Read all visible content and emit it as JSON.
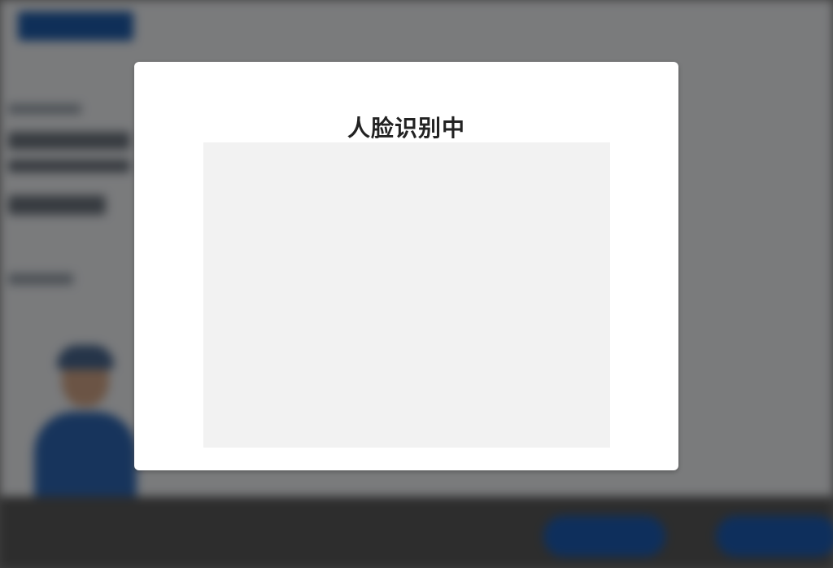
{
  "face_recognition_modal": {
    "title": "人脸识别中"
  },
  "colors": {
    "overlay": "rgba(0,0,0,0.5)",
    "modal_background": "#ffffff",
    "camera_placeholder": "#f2f2f2",
    "title_text": "#222222",
    "background_accent": "#1f5fb0"
  }
}
